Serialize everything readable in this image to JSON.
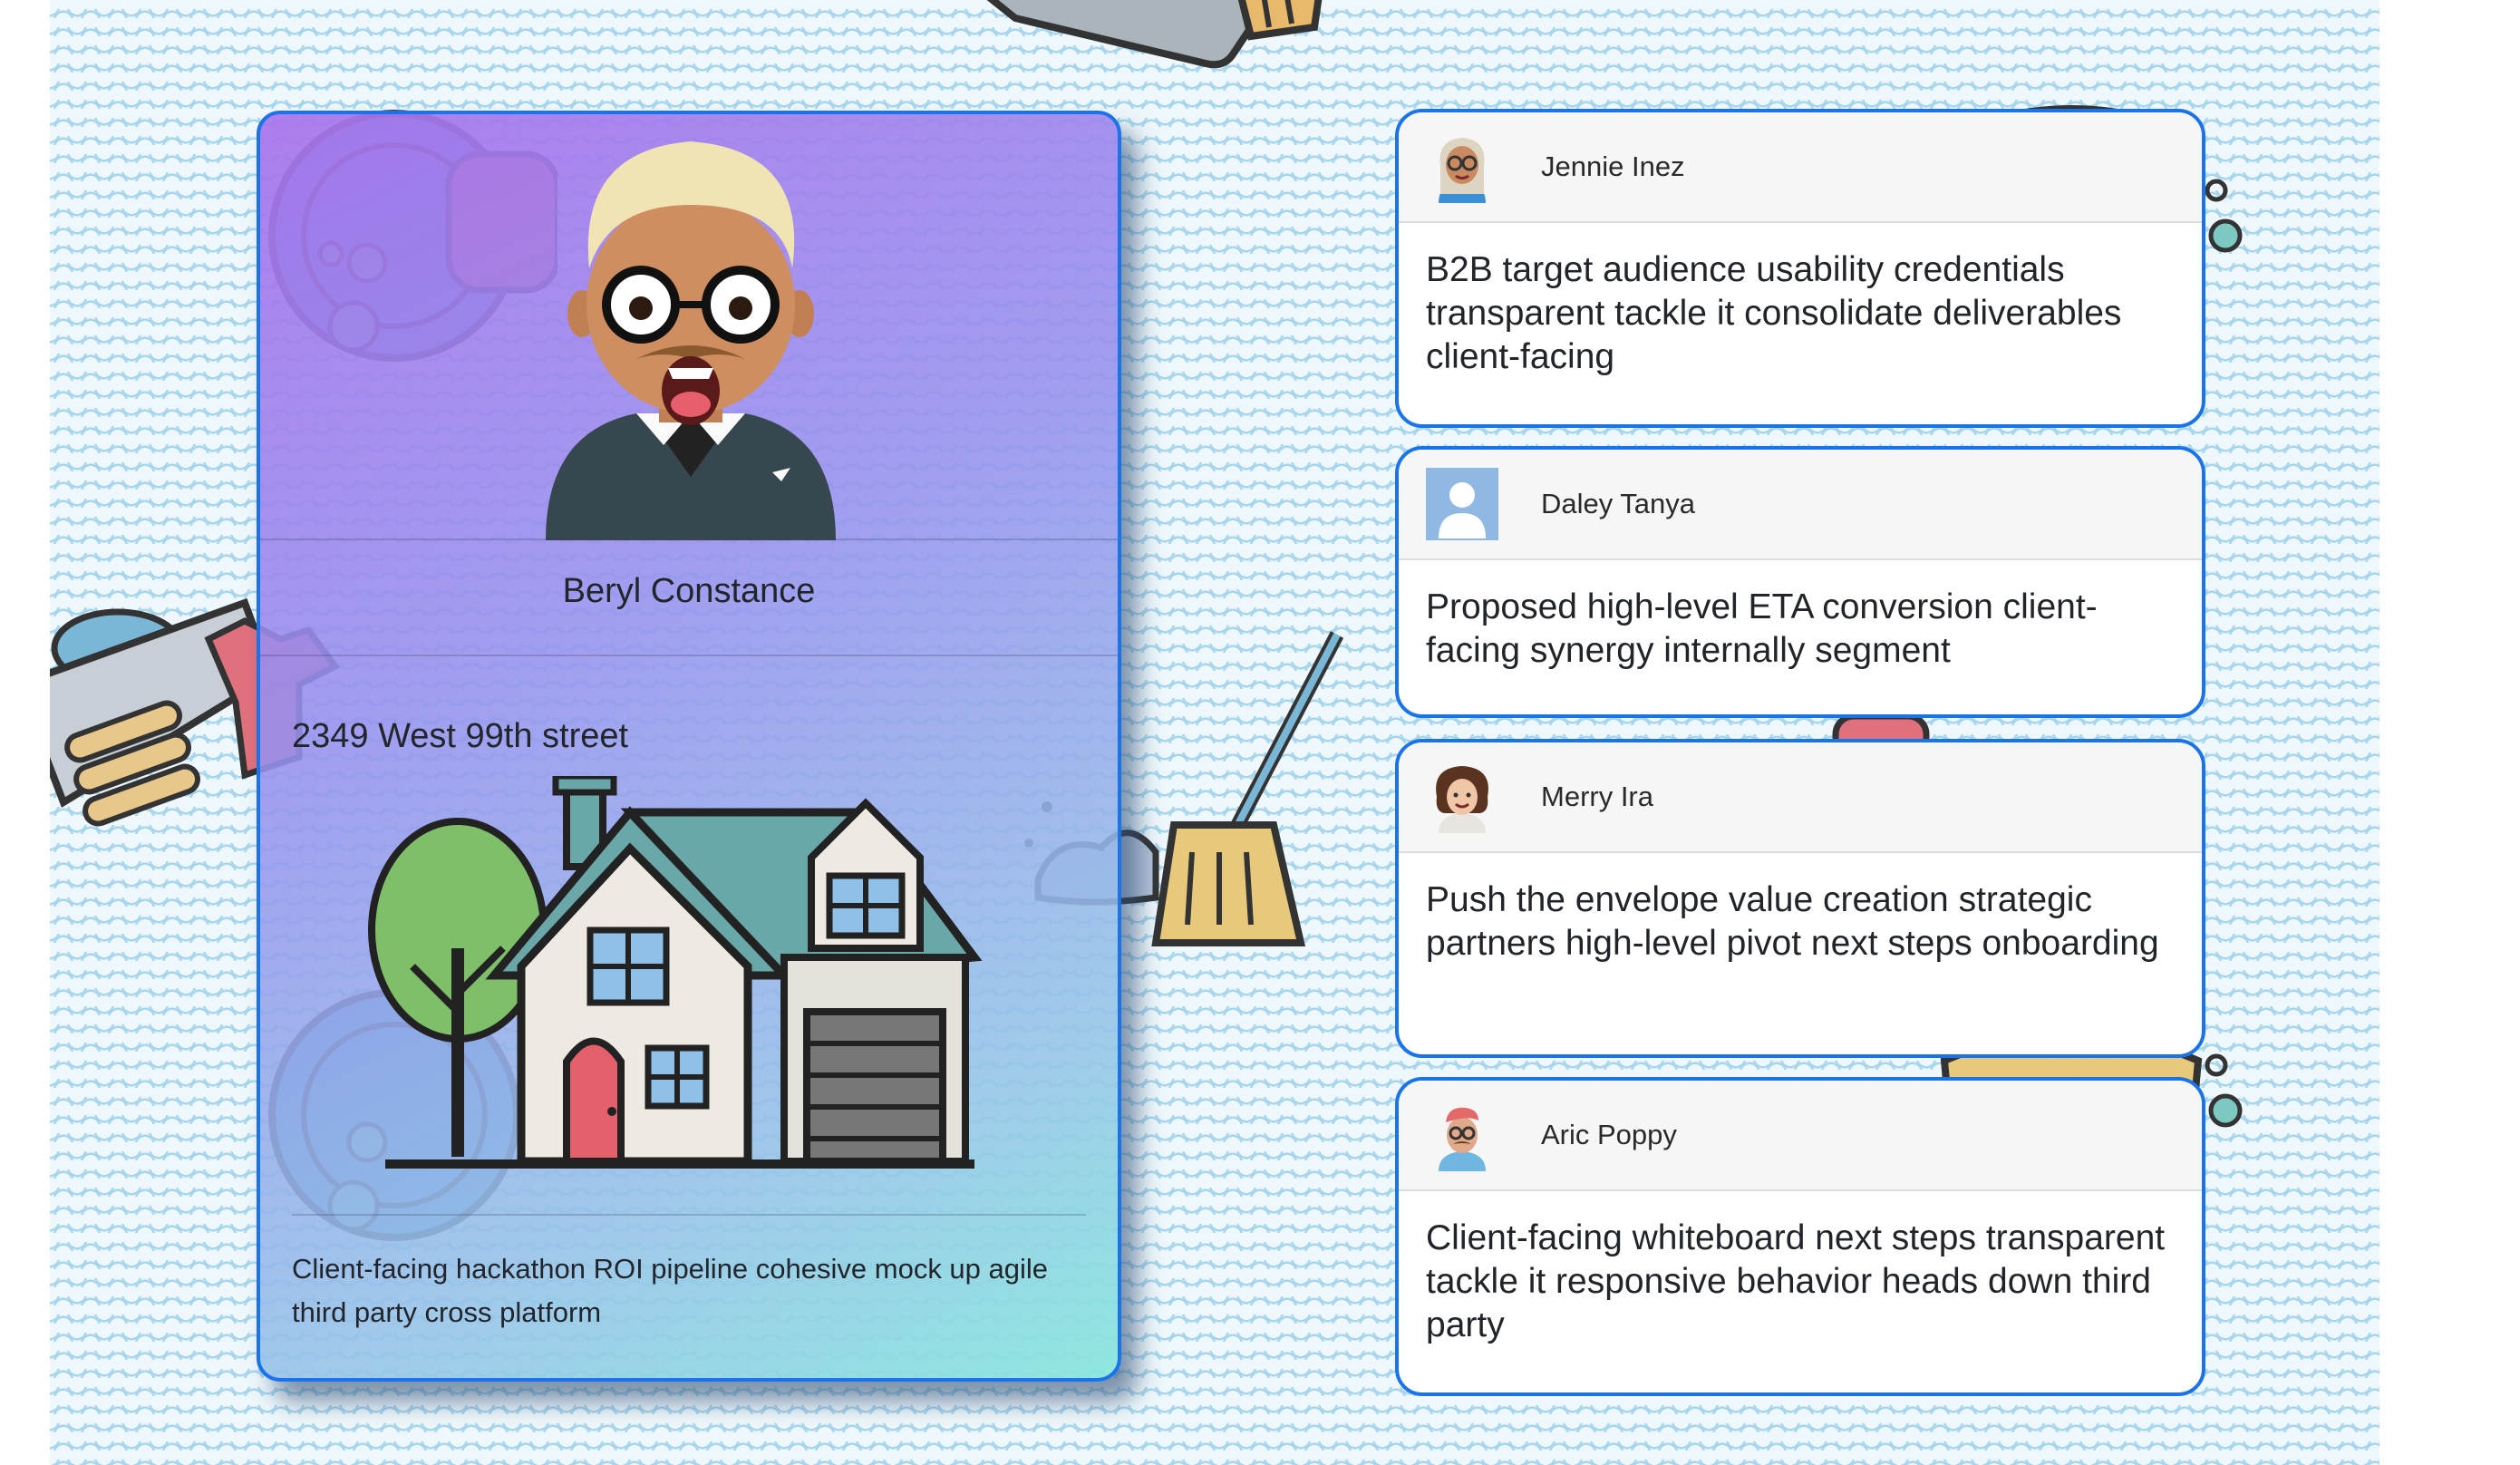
{
  "profile": {
    "name": "Beryl Constance",
    "address": "2349 West 99th street",
    "description": "Client-facing hackathon ROI pipeline cohesive mock up agile third party cross platform",
    "avatar_icon": "man-with-glasses-surprised-avatar",
    "house_icon": "house-illustration"
  },
  "messages": [
    {
      "author": "Jennie Inez",
      "avatar_icon": "woman-with-glasses-avatar",
      "text": "B2B target audience usability credentials transparent tackle it consolidate deliverables client-facing"
    },
    {
      "author": "Daley Tanya",
      "avatar_icon": "default-user-avatar",
      "text": "Proposed high-level ETA conversion client-facing synergy internally segment"
    },
    {
      "author": "Merry Ira",
      "avatar_icon": "curly-hair-woman-avatar",
      "text": "Push the envelope value creation strategic partners high-level pivot next steps onboarding"
    },
    {
      "author": "Aric Poppy",
      "avatar_icon": "man-with-mustache-avatar",
      "text": "Client-facing whiteboard next steps transparent tackle it responsive behavior heads down third party"
    }
  ],
  "colors": {
    "card_border": "#1a73e8",
    "background_wave": "#a7d6ec"
  }
}
